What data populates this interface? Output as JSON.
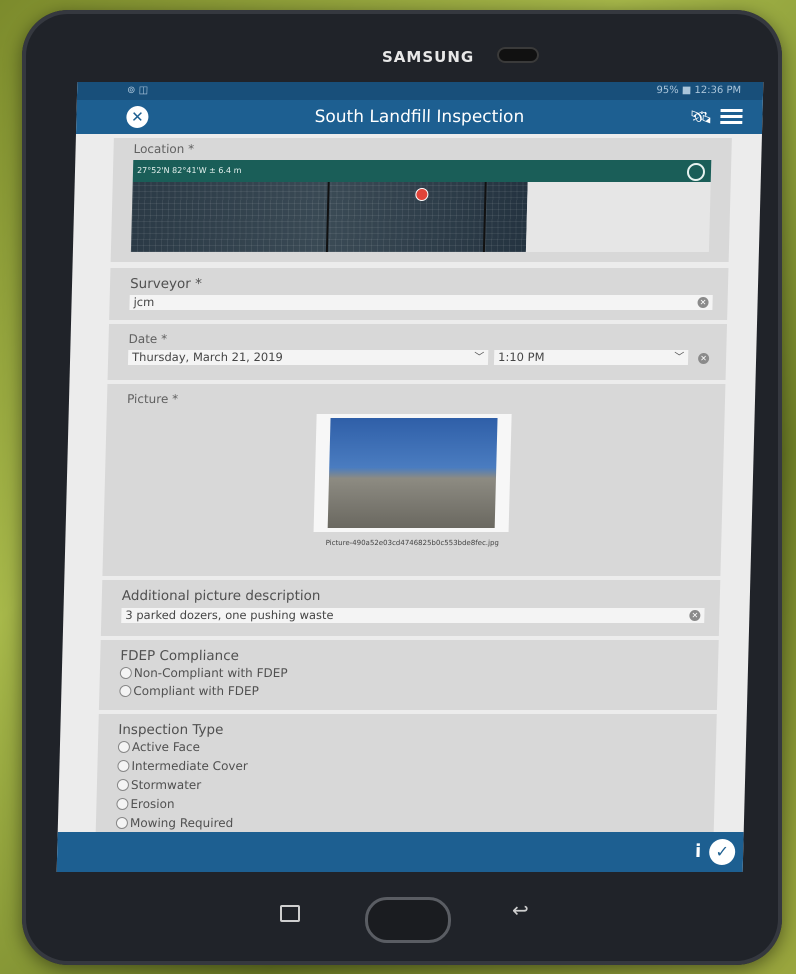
{
  "device": {
    "brand": "SAMSUNG"
  },
  "statusbar": {
    "left_icons": "⊚ ◫",
    "right_text": "95% ■ 12:36 PM"
  },
  "header": {
    "title": "South Landfill Inspection",
    "close_icon": "close-icon",
    "satellite_icon": "satellite-icon",
    "menu_icon": "menu-icon"
  },
  "form": {
    "location": {
      "label": "Location *",
      "coordinates": "27°52'N 82°41'W ± 6.4 m"
    },
    "surveyor": {
      "label": "Surveyor *",
      "value": "jcm"
    },
    "date": {
      "label": "Date *",
      "date_value": "Thursday, March 21, 2019",
      "time_value": "1:10 PM"
    },
    "picture": {
      "label": "Picture *",
      "filename": "Picture-490a52e03cd4746825b0c553bde8fec.jpg"
    },
    "additional_description": {
      "label": "Additional picture description",
      "value": "3 parked dozers, one pushing waste"
    },
    "fdep_compliance": {
      "label": "FDEP Compliance",
      "options": [
        "Non-Compliant with FDEP",
        "Compliant with FDEP"
      ]
    },
    "inspection_type": {
      "label": "Inspection Type",
      "options": [
        "Active Face",
        "Intermediate Cover",
        "Stormwater",
        "Erosion",
        "Mowing Required"
      ]
    }
  },
  "footer": {
    "info_icon": "info-icon",
    "submit_icon": "checkmark-icon"
  },
  "colors": {
    "header_blue": "#1d5f91",
    "location_bar": "#1a5e58",
    "section_bg": "#d8d8d8"
  }
}
